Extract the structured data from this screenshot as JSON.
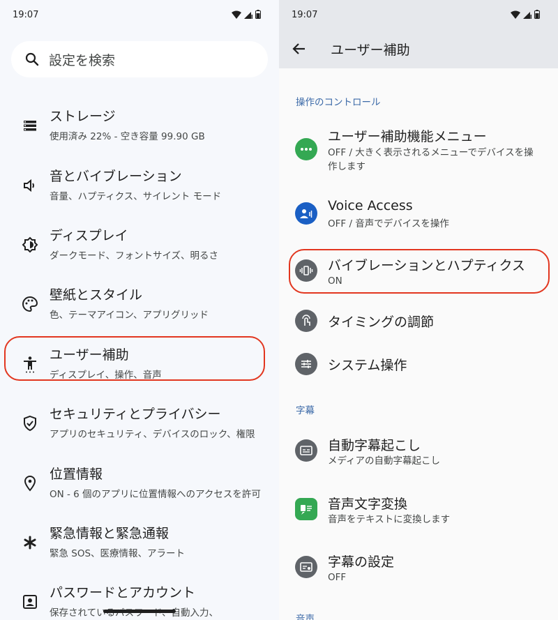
{
  "left": {
    "status_time": "19:07",
    "search_placeholder": "設定を検索",
    "items": [
      {
        "title": "ストレージ",
        "subtitle": "使用済み 22% - 空き容量 99.90 GB",
        "icon": "storage-icon"
      },
      {
        "title": "音とバイブレーション",
        "subtitle": "音量、ハプティクス、サイレント モード",
        "icon": "volume-icon"
      },
      {
        "title": "ディスプレイ",
        "subtitle": "ダークモード、フォントサイズ、明るさ",
        "icon": "brightness-icon"
      },
      {
        "title": "壁紙とスタイル",
        "subtitle": "色、テーマアイコン、アプリグリッド",
        "icon": "palette-icon"
      },
      {
        "title": "ユーザー補助",
        "subtitle": "ディスプレイ、操作、音声",
        "icon": "accessibility-icon",
        "highlighted": true
      },
      {
        "title": "セキュリティとプライバシー",
        "subtitle": "アプリのセキュリティ、デバイスのロック、権限",
        "icon": "shield-icon"
      },
      {
        "title": "位置情報",
        "subtitle": "ON - 6 個のアプリに位置情報へのアクセスを許可",
        "icon": "location-icon"
      },
      {
        "title": "緊急情報と緊急通報",
        "subtitle": "緊急 SOS、医療情報、アラート",
        "icon": "asterisk-icon"
      },
      {
        "title": "パスワードとアカウント",
        "subtitle": "保存されているパスワード、自動入力、",
        "icon": "account-icon"
      }
    ]
  },
  "right": {
    "status_time": "19:07",
    "title": "ユーザー補助",
    "sections": {
      "controls": "操作のコントロール",
      "captions": "字幕",
      "audio": "音声"
    },
    "items": [
      {
        "title": "ユーザー補助機能メニュー",
        "subtitle": "OFF / 大きく表示されるメニューでデバイスを操作します",
        "icon": "menu-dots-icon"
      },
      {
        "title": "Voice Access",
        "subtitle": "OFF / 音声でデバイスを操作",
        "icon": "voice-access-icon"
      },
      {
        "title": "バイブレーションとハプティクス",
        "subtitle": "ON",
        "icon": "vibration-icon",
        "highlighted": true
      },
      {
        "title": "タイミングの調節",
        "subtitle": "",
        "icon": "touch-timer-icon"
      },
      {
        "title": "システム操作",
        "subtitle": "",
        "icon": "sliders-icon"
      },
      {
        "title": "自動字幕起こし",
        "subtitle": "メディアの自動字幕起こし",
        "icon": "caption-icon"
      },
      {
        "title": "音声文字変換",
        "subtitle": "音声をテキストに変換します",
        "icon": "transcribe-icon"
      },
      {
        "title": "字幕の設定",
        "subtitle": "OFF",
        "icon": "caption-settings-icon"
      }
    ]
  },
  "colors": {
    "highlight": "#e2361f",
    "section_text": "#3c6aa8",
    "green": "#34a853",
    "blue": "#1a5fc4",
    "gray_icon": "#5f6368"
  }
}
